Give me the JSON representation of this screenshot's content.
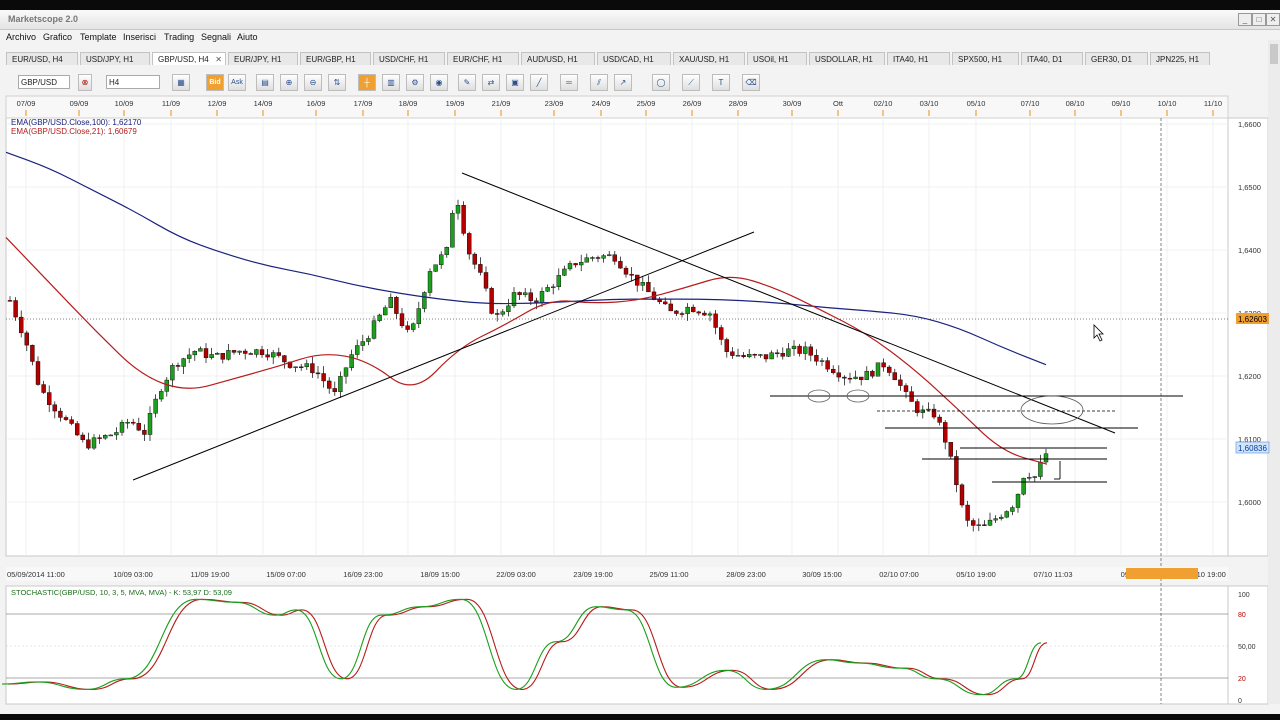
{
  "app": {
    "title": "Marketscope 2.0"
  },
  "window_controls": [
    "_",
    "□",
    "✕"
  ],
  "menu": [
    "Archivo",
    "Grafico",
    "Template",
    "Inserisci",
    "Trading",
    "Segnali",
    "Aiuto"
  ],
  "tabs": [
    "EUR/USD, H4",
    "USD/JPY, H1",
    "GBP/USD, H4",
    "EUR/JPY, H1",
    "EUR/GBP, H1",
    "USD/CHF, H1",
    "EUR/CHF, H1",
    "AUD/USD, H1",
    "USD/CAD, H1",
    "XAU/USD, H1",
    "USOil, H1",
    "USDOLLAR, H1",
    "ITA40, H1",
    "SPX500, H1",
    "ITA40, D1",
    "GER30, D1",
    "JPN225, H1"
  ],
  "active_tab": "GBP/USD, H4",
  "toolbar": {
    "symbol": "GBP/USD",
    "timeframe": "H4",
    "bid_label": "Bid",
    "ask_label": "Ask"
  },
  "chart": {
    "top_dates": [
      "07/09",
      "09/09",
      "10/09",
      "11/09",
      "12/09",
      "14/09",
      "16/09",
      "17/09",
      "18/09",
      "19/09",
      "21/09",
      "23/09",
      "24/09",
      "25/09",
      "26/09",
      "28/09",
      "30/09",
      "Ott",
      "02/10",
      "03/10",
      "05/10",
      "07/10",
      "08/10",
      "09/10",
      "10/10",
      "11/10"
    ],
    "bottom_dates": [
      "05/09/2014 11:00",
      "10/09 03:00",
      "11/09 19:00",
      "15/09 07:00",
      "16/09 23:00",
      "18/09 15:00",
      "22/09 03:00",
      "23/09 19:00",
      "25/09 11:00",
      "28/09 23:00",
      "30/09 15:00",
      "02/10 07:00",
      "05/10 19:00",
      "07/10 11:03",
      "09/10",
      "10/09/2014 19:00",
      "10/10 19:00"
    ],
    "legend": [
      {
        "text": "EMA(GBP/USD.Close,100): 1,62170",
        "color": "#1a237e"
      },
      {
        "text": "EMA(GBP/USD.Close,21): 1,60679",
        "color": "#b71c1c"
      }
    ],
    "y_ticks": [
      "1,6600",
      "1,6500",
      "1,6400",
      "1,6300",
      "1,6200",
      "1,6100",
      "1,6000"
    ],
    "price_tag": "1,62603",
    "current_price": "1,60836",
    "colors": {
      "up": "#1e9e1e",
      "down": "#b00000",
      "ema100": "#1a237e",
      "ema21": "#b71c1c",
      "stoch_k": "#1a9e1a",
      "stoch_d": "#b71c1c",
      "crosshair_tag": "#f0a030"
    }
  },
  "stochastic": {
    "label": "STOCHASTIC(GBP/USD, 10, 3, 5, MVA, MVA) - K: 53,97   D: 53,09",
    "y_ticks": [
      "100",
      "80",
      "50,00",
      "20",
      "0"
    ]
  },
  "chart_data": {
    "type": "line",
    "title": "",
    "xlabel": "",
    "ylabel": "",
    "ylim": [
      1.592,
      1.6615
    ],
    "series": [
      {
        "name": "EMA(GBP/USD.Close,100)",
        "values": [
          1.6555,
          1.653,
          1.6495,
          1.646,
          1.642,
          1.6395,
          1.6375,
          1.6362,
          1.6345,
          1.6332,
          1.6322,
          1.6315,
          1.6315,
          1.6318,
          1.6322,
          1.6322,
          1.6322,
          1.632,
          1.6315,
          1.6308,
          1.6303,
          1.6296,
          1.6276,
          1.6245,
          1.6218
        ]
      },
      {
        "name": "EMA(GBP/USD.Close,21)",
        "values": [
          1.642,
          1.6345,
          1.627,
          1.62,
          1.6175,
          1.6195,
          1.6215,
          1.6238,
          1.6225,
          1.617,
          1.6245,
          1.628,
          1.6322,
          1.6315,
          1.632,
          1.634,
          1.6362,
          1.634,
          1.6305,
          1.6268,
          1.6215,
          1.615,
          1.608,
          1.606
        ]
      }
    ],
    "stochastic": {
      "name": "STOCHASTIC(GBP/USD, 10, 3, 5, MVA, MVA)",
      "ylim": [
        0,
        100
      ],
      "K": 53.97,
      "D": 53.09
    }
  }
}
